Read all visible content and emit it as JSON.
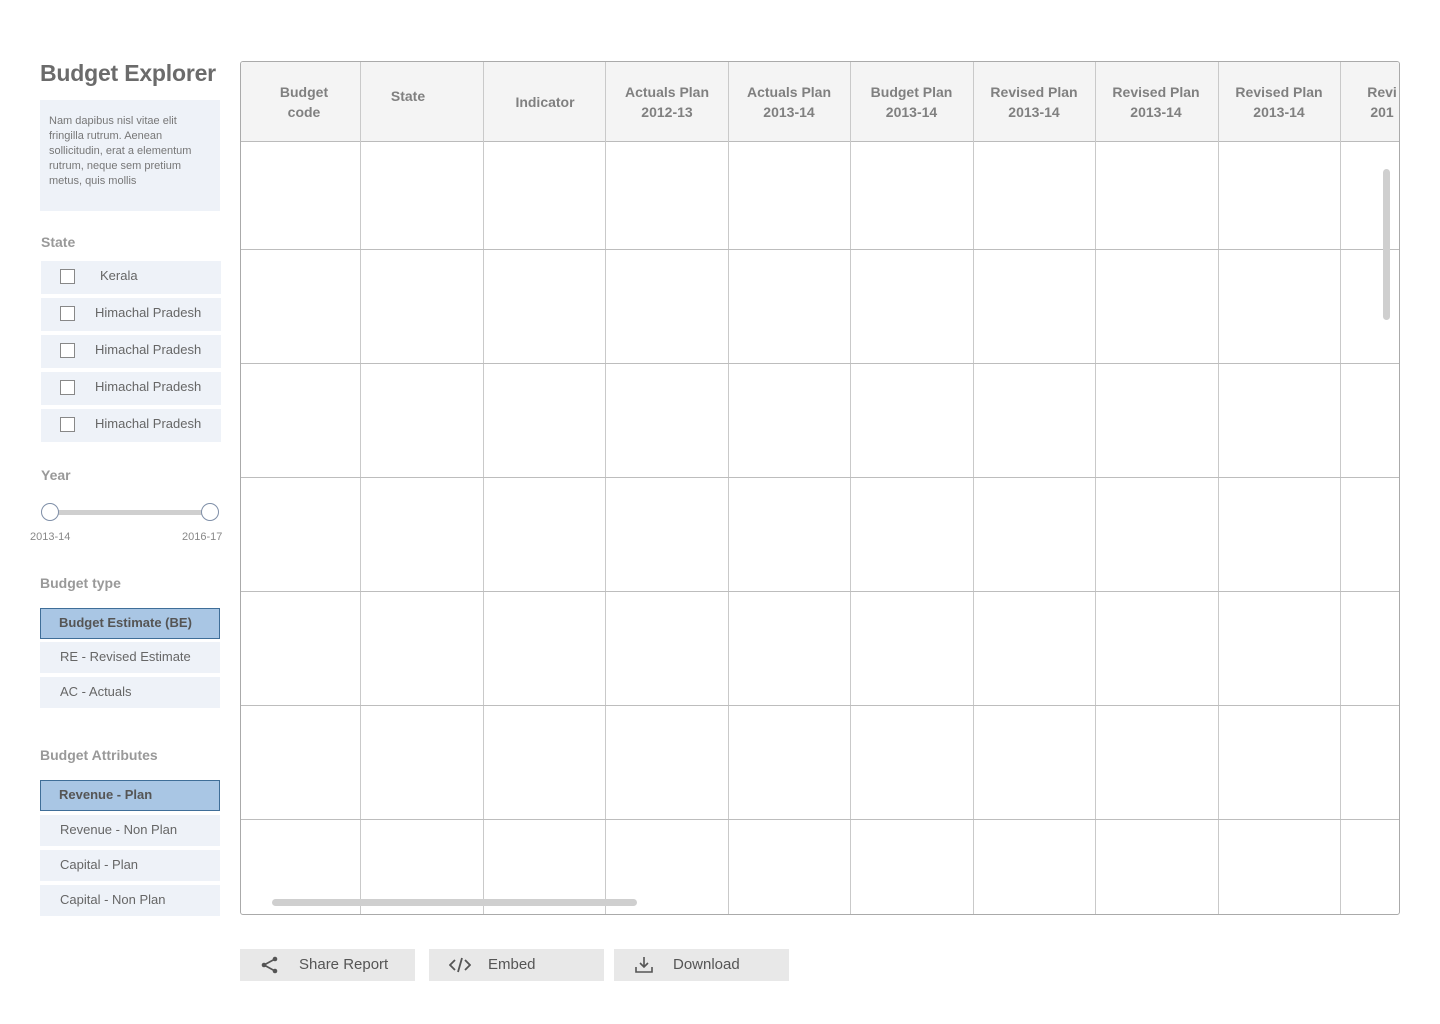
{
  "app": {
    "title": "Budget Explorer",
    "description": "Nam dapibus nisl vitae elit fringilla rutrum. Aenean sollicitudin, erat a elementum rutrum, neque sem pretium metus, quis mollis"
  },
  "filters": {
    "state_label": "State",
    "states": [
      "Kerala",
      "Himachal Pradesh",
      "Himachal Pradesh",
      "Himachal Pradesh",
      "Himachal Pradesh"
    ],
    "year_label": "Year",
    "year_min": "2013-14",
    "year_max": "2016-17",
    "budget_type_label": "Budget type",
    "budget_types": [
      "Budget Estimate (BE)",
      "RE - Revised Estimate",
      "AC - Actuals"
    ],
    "budget_type_selected": "Budget Estimate (BE)",
    "attributes_label": "Budget Attributes",
    "attributes": [
      "Revenue - Plan",
      "Revenue - Non Plan",
      "Capital - Plan",
      "Capital - Non Plan"
    ],
    "attribute_selected": "Revenue - Plan"
  },
  "table": {
    "columns": [
      [
        "Budget",
        "code"
      ],
      [
        "State"
      ],
      [
        "Indicator"
      ],
      [
        "Actuals Plan",
        "2012-13"
      ],
      [
        "Actuals Plan",
        "2013-14"
      ],
      [
        "Budget Plan",
        "2013-14"
      ],
      [
        "Revised Plan",
        "2013-14"
      ],
      [
        "Revised Plan",
        "2013-14"
      ],
      [
        "Revised Plan",
        "2013-14"
      ],
      [
        "Revi",
        "201"
      ]
    ],
    "rows": [
      [
        "",
        "",
        "",
        "",
        "",
        "",
        "",
        "",
        "",
        ""
      ],
      [
        "",
        "",
        "",
        "",
        "",
        "",
        "",
        "",
        "",
        ""
      ],
      [
        "",
        "",
        "",
        "",
        "",
        "",
        "",
        "",
        "",
        ""
      ],
      [
        "",
        "",
        "",
        "",
        "",
        "",
        "",
        "",
        "",
        ""
      ],
      [
        "",
        "",
        "",
        "",
        "",
        "",
        "",
        "",
        "",
        ""
      ],
      [
        "",
        "",
        "",
        "",
        "",
        "",
        "",
        "",
        "",
        ""
      ],
      [
        "",
        "",
        "",
        "",
        "",
        "",
        "",
        "",
        "",
        ""
      ]
    ]
  },
  "actions": {
    "share_label": "Share Report",
    "embed_label": "Embed",
    "download_label": "Download",
    "share_icon": "share-icon",
    "embed_icon": "code-icon",
    "download_icon": "download-icon"
  },
  "colors": {
    "selected_bg": "#a9c6e4",
    "selected_border": "#3f6e98",
    "panel_bg": "#eef2f8"
  }
}
